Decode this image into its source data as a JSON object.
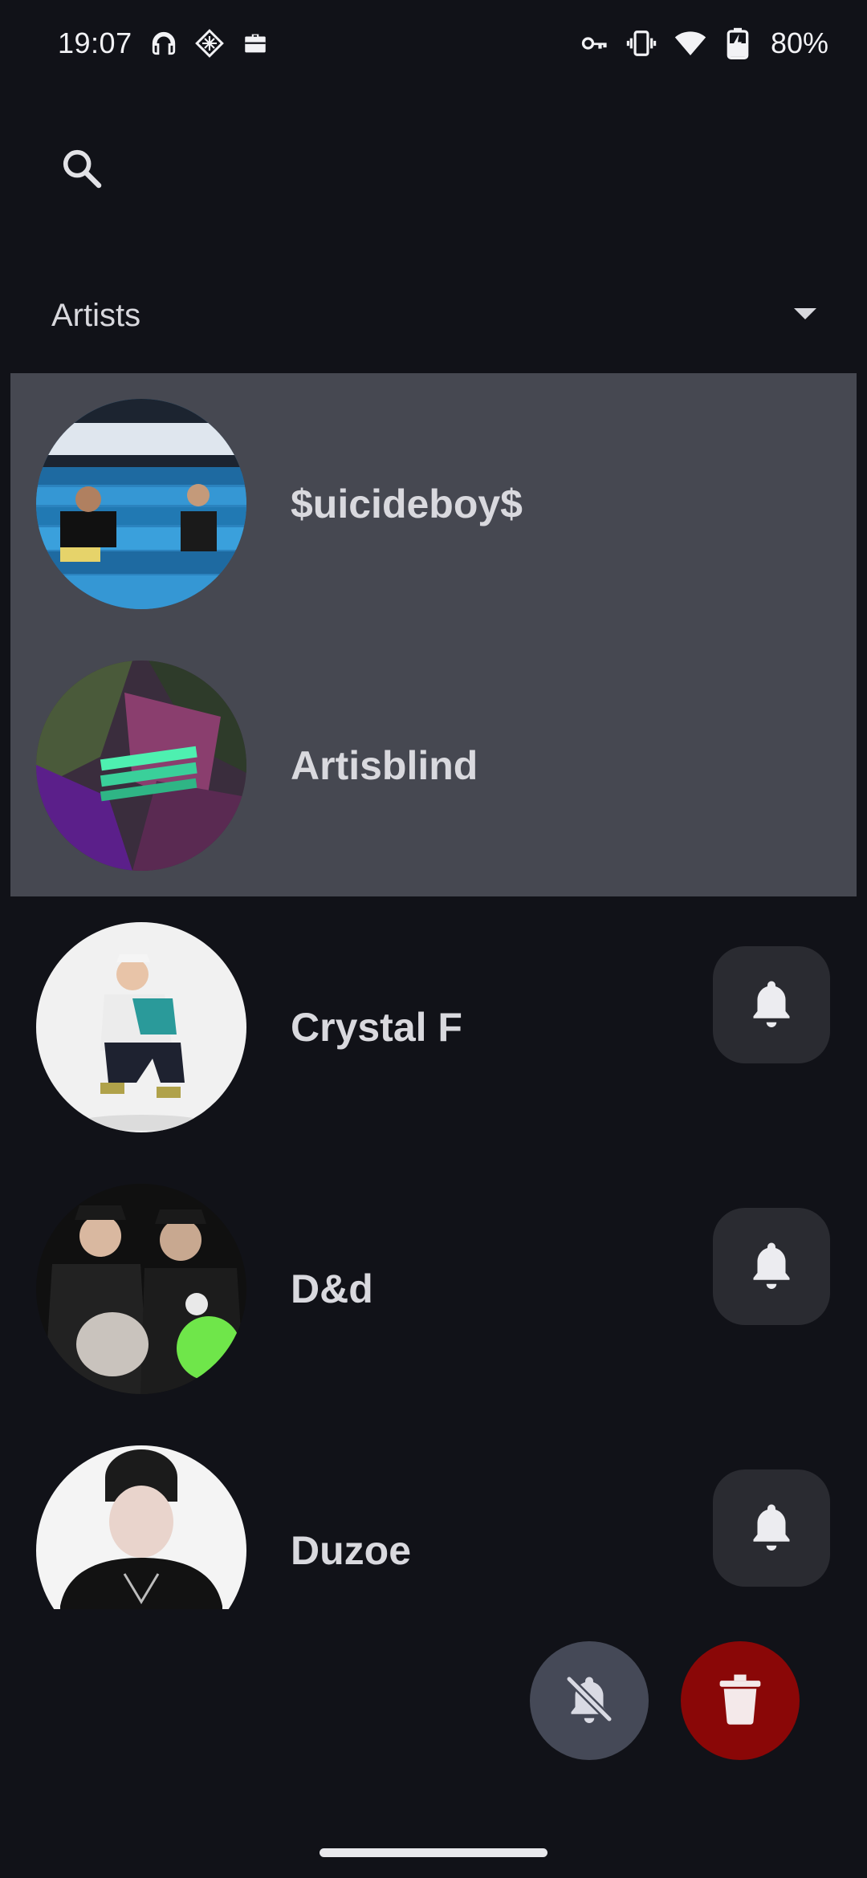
{
  "status_bar": {
    "time": "19:07",
    "battery": "80%",
    "left_icons": [
      "headphones-icon",
      "app-shortcut-icon",
      "work-briefcase-icon"
    ],
    "right_icons": [
      "vpn-key-icon",
      "vibrate-icon",
      "wifi-icon",
      "battery-charging-icon"
    ]
  },
  "search": {
    "icon": "search-icon"
  },
  "category": {
    "selected": "Artists",
    "icon": "dropdown-arrow-icon"
  },
  "artists": [
    {
      "name": "$uicideboy$",
      "selected": true,
      "show_bell": false
    },
    {
      "name": "Artisblind",
      "selected": true,
      "show_bell": false
    },
    {
      "name": "Crystal F",
      "selected": false,
      "show_bell": true
    },
    {
      "name": "D&d",
      "selected": false,
      "show_bell": true
    },
    {
      "name": "Duzoe",
      "selected": false,
      "show_bell": true
    }
  ],
  "actions": {
    "mute_icon": "notifications-off-icon",
    "delete_icon": "trash-icon"
  },
  "colors": {
    "background": "#111218",
    "selection": "#464851",
    "bell_button": "#2a2b31",
    "mute_fab": "#454957",
    "delete_fab": "#8a0707",
    "text": "#d9d9de"
  }
}
